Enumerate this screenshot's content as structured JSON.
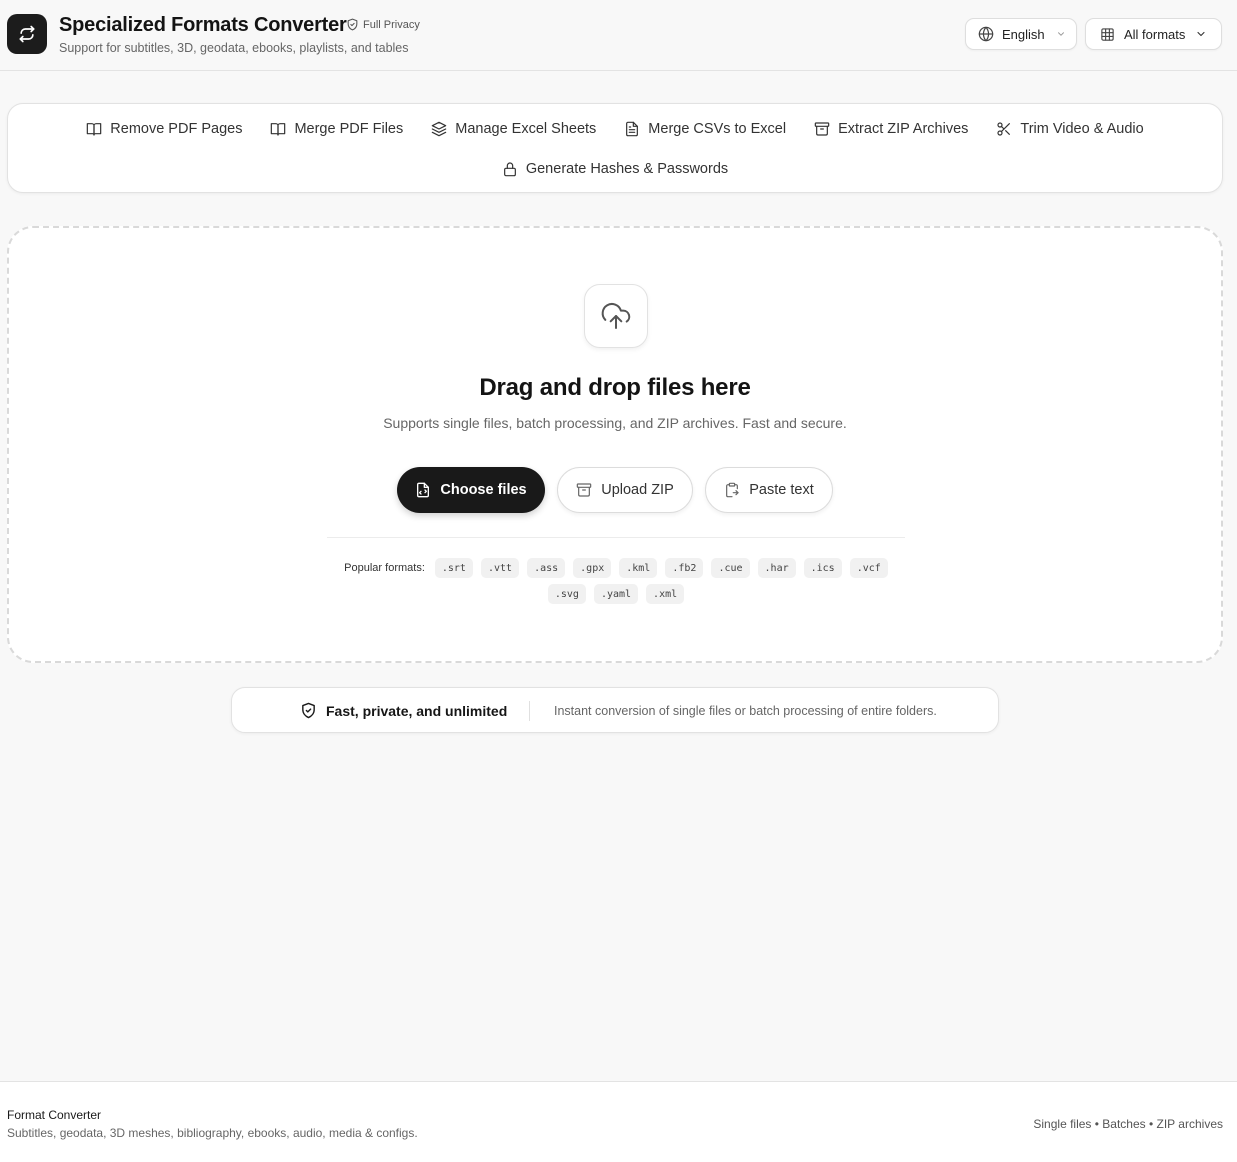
{
  "header": {
    "title": "Specialized Formats Converter",
    "privacy_badge": "Full Privacy",
    "subtitle": "Support for subtitles, 3D, geodata, ebooks, playlists, and tables",
    "language": "English",
    "formats_filter": "All formats"
  },
  "tools": [
    {
      "label": "Remove PDF Pages",
      "icon": "book-open-icon"
    },
    {
      "label": "Merge PDF Files",
      "icon": "book-open-icon"
    },
    {
      "label": "Manage Excel Sheets",
      "icon": "layers-icon"
    },
    {
      "label": "Merge CSVs to Excel",
      "icon": "file-text-icon"
    },
    {
      "label": "Extract ZIP Archives",
      "icon": "archive-icon"
    },
    {
      "label": "Trim Video & Audio",
      "icon": "scissors-icon"
    },
    {
      "label": "Generate Hashes & Passwords",
      "icon": "lock-icon"
    }
  ],
  "dropzone": {
    "title": "Drag and drop files here",
    "subtitle": "Supports single files, batch processing, and ZIP archives. Fast and secure.",
    "choose_files": "Choose files",
    "upload_zip": "Upload ZIP",
    "paste_text": "Paste text",
    "popular_label": "Popular formats:",
    "formats": [
      ".srt",
      ".vtt",
      ".ass",
      ".gpx",
      ".kml",
      ".fb2",
      ".cue",
      ".har",
      ".ics",
      ".vcf",
      ".svg",
      ".yaml",
      ".xml"
    ]
  },
  "info": {
    "headline": "Fast, private, and unlimited",
    "description": "Instant conversion of single files or batch processing of entire folders."
  },
  "footer": {
    "title": "Format Converter",
    "subtitle": "Subtitles, geodata, 3D meshes, bibliography, ebooks, audio, media & configs.",
    "right": "Single files • Batches • ZIP archives"
  },
  "colors": {
    "primary": "#191919",
    "background": "#f8f8f8",
    "card": "#ffffff"
  }
}
